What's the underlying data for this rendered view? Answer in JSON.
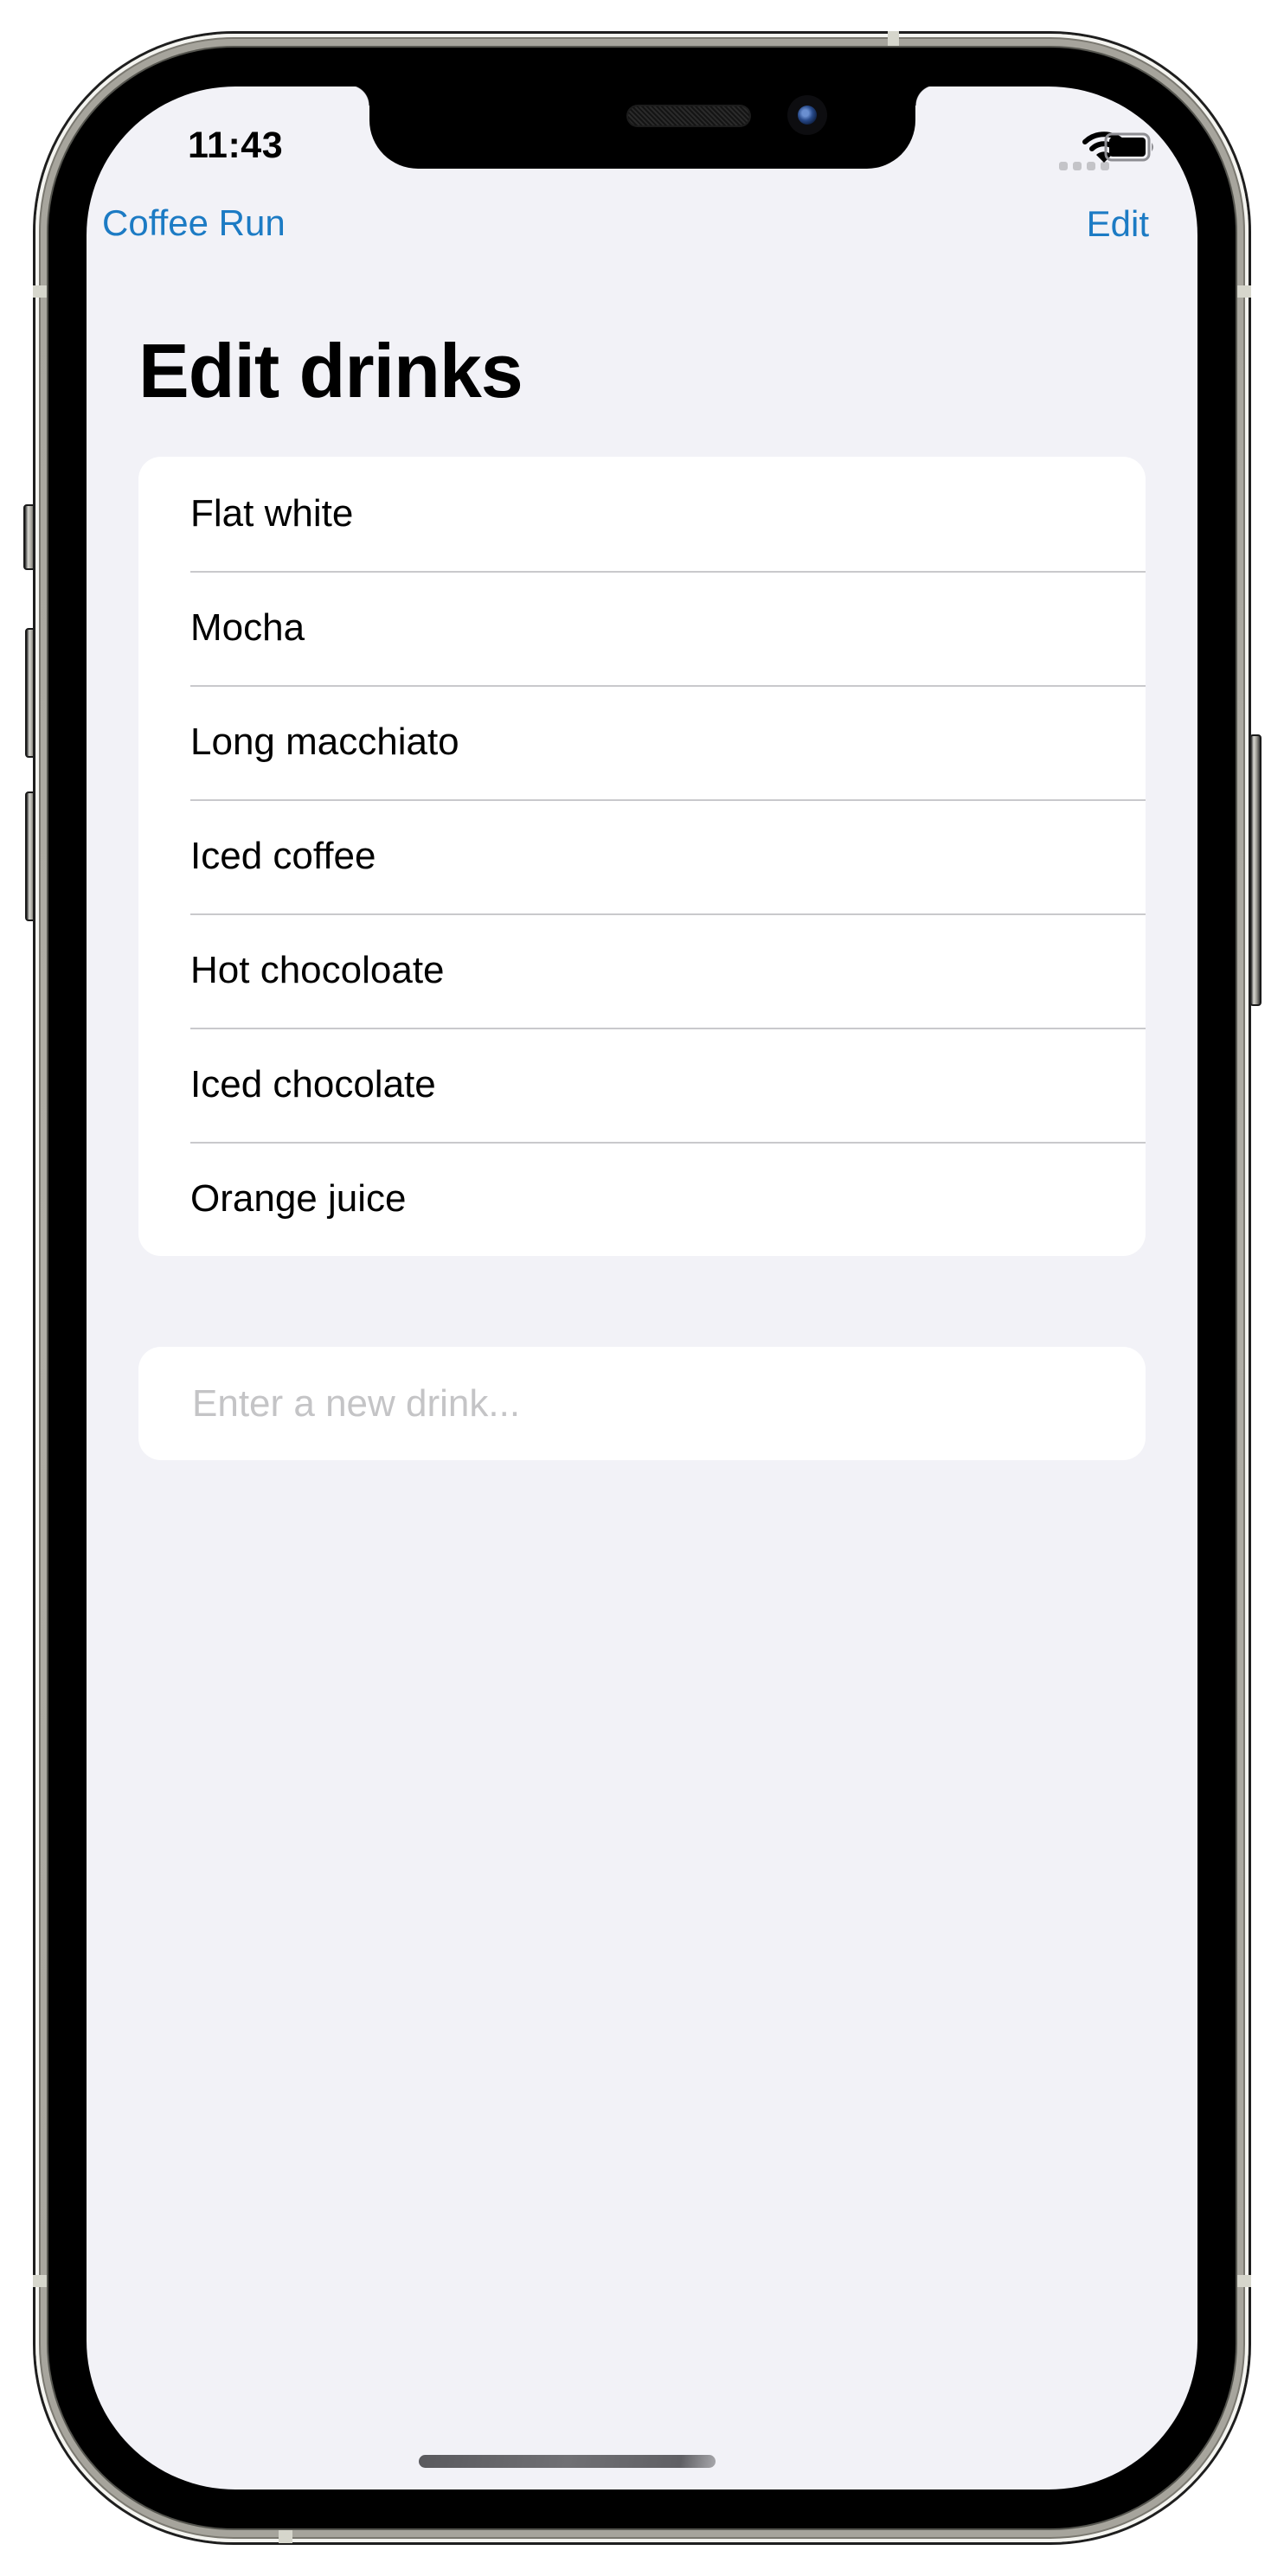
{
  "status_bar": {
    "time": "11:43",
    "signal_icon": "cellular-signal-icon",
    "wifi_icon": "wifi-icon",
    "battery_icon": "battery-icon"
  },
  "nav": {
    "back_label": "Coffee Run",
    "back_icon": "chevron-left-icon",
    "edit_label": "Edit"
  },
  "page": {
    "title": "Edit drinks"
  },
  "drinks": [
    {
      "label": "Flat white"
    },
    {
      "label": "Mocha"
    },
    {
      "label": "Long macchiato"
    },
    {
      "label": "Iced coffee"
    },
    {
      "label": "Hot chocoloate"
    },
    {
      "label": "Iced chocolate"
    },
    {
      "label": "Orange juice"
    }
  ],
  "new_drink": {
    "value": "",
    "placeholder": "Enter a new drink..."
  },
  "colors": {
    "accent": "#1c7bc4",
    "background": "#f2f2f7",
    "card": "#ffffff",
    "separator": "#c9c9cc",
    "placeholder": "#c4c4c6"
  }
}
